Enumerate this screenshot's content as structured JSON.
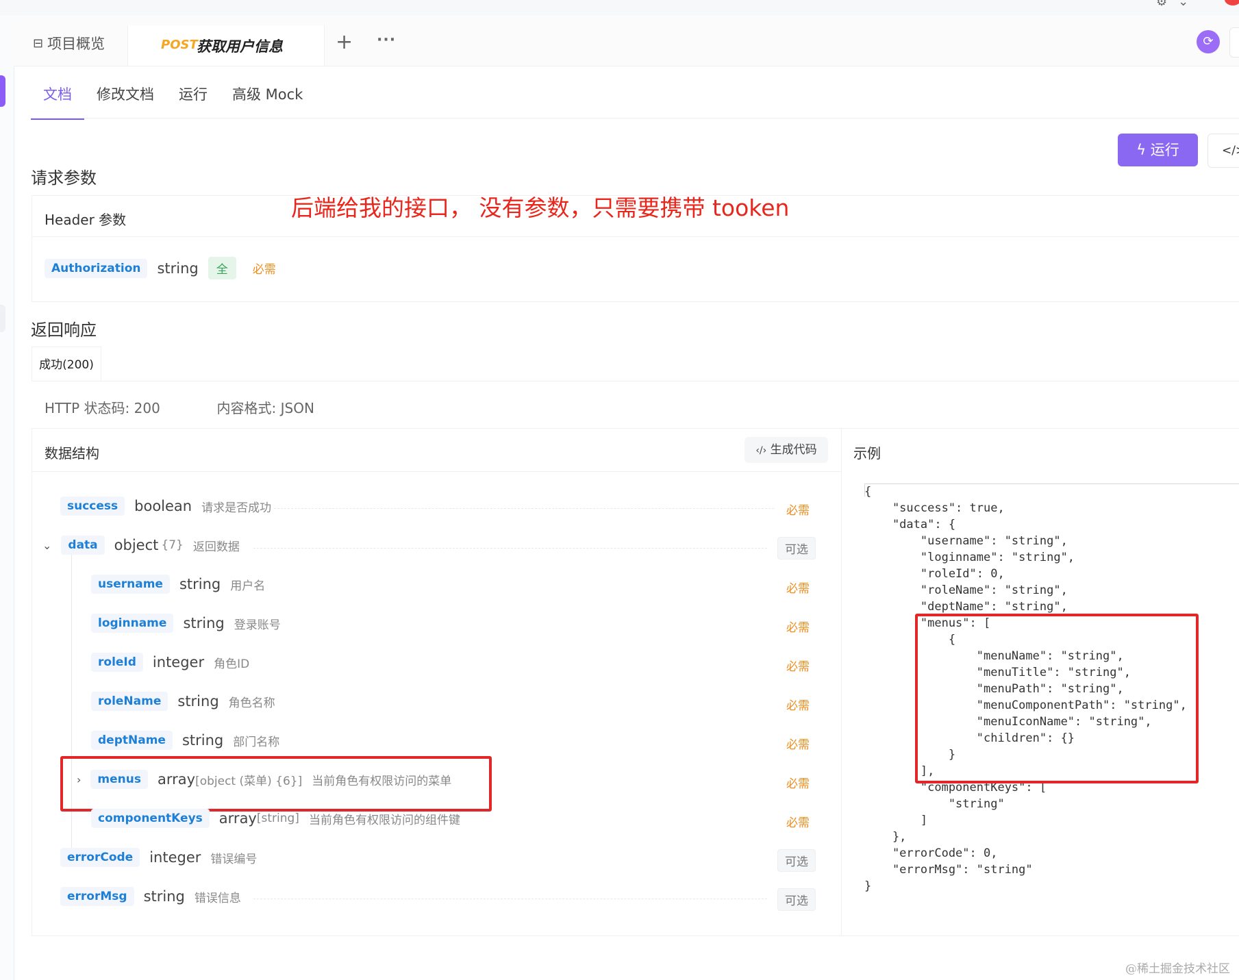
{
  "tabs": {
    "overview": "项目概览",
    "api_method": "POST",
    "api_name": "获取用户信息",
    "add": "+",
    "more": "···"
  },
  "subtabs": [
    "文档",
    "修改文档",
    "运行",
    "高级 Mock"
  ],
  "run_button": "运行",
  "code_button": "</>",
  "request": {
    "title": "请求参数",
    "header_label": "Header 参数",
    "annotation": "后端给我的接口， 没有参数，只需要携带 tooken",
    "param": {
      "name": "Authorization",
      "type": "string",
      "tag": "全",
      "required": "必需"
    }
  },
  "response": {
    "title": "返回响应",
    "status_tab": "成功(200)",
    "http_status": "HTTP 状态码: 200",
    "content_type": "内容格式: JSON",
    "struct_title": "数据结构",
    "gen_code": "生成代码",
    "example_title": "示例",
    "fields": [
      {
        "name": "success",
        "type": "boolean",
        "desc": "请求是否成功",
        "flag": "必需"
      },
      {
        "name": "data",
        "type": "object",
        "extra": "{7}",
        "desc": "返回数据",
        "flag": "可选"
      },
      {
        "name": "username",
        "type": "string",
        "desc": "用户名",
        "flag": "必需"
      },
      {
        "name": "loginname",
        "type": "string",
        "desc": "登录账号",
        "flag": "必需"
      },
      {
        "name": "roleId",
        "type": "integer",
        "desc": "角色ID",
        "flag": "必需"
      },
      {
        "name": "roleName",
        "type": "string",
        "desc": "角色名称",
        "flag": "必需"
      },
      {
        "name": "deptName",
        "type": "string",
        "desc": "部门名称",
        "flag": "必需"
      },
      {
        "name": "menus",
        "type": "array",
        "extra": "[object (菜单) {6}]",
        "desc": "当前角色有权限访问的菜单",
        "flag": "必需"
      },
      {
        "name": "componentKeys",
        "type": "array",
        "extra": "[string]",
        "desc": "当前角色有权限访问的组件键",
        "flag": "必需"
      },
      {
        "name": "errorCode",
        "type": "integer",
        "desc": "错误编号",
        "flag": "可选"
      },
      {
        "name": "errorMsg",
        "type": "string",
        "desc": "错误信息",
        "flag": "可选"
      }
    ]
  },
  "example_json": "{\n    \"success\": true,\n    \"data\": {\n        \"username\": \"string\",\n        \"loginname\": \"string\",\n        \"roleId\": 0,\n        \"roleName\": \"string\",\n        \"deptName\": \"string\",\n        \"menus\": [\n            {\n                \"menuName\": \"string\",\n                \"menuTitle\": \"string\",\n                \"menuPath\": \"string\",\n                \"menuComponentPath\": \"string\",\n                \"menuIconName\": \"string\",\n                \"children\": {}\n            }\n        ],\n        \"componentKeys\": [\n            \"string\"\n        ]\n    },\n    \"errorCode\": 0,\n    \"errorMsg\": \"string\"\n}",
  "watermark": "@稀土掘金技术社区",
  "colors": {
    "accent": "#7b5cf0",
    "annotation": "#e8261b",
    "highlight": "#e12727",
    "required": "#f08c1a",
    "field": "#1e7fd6"
  }
}
